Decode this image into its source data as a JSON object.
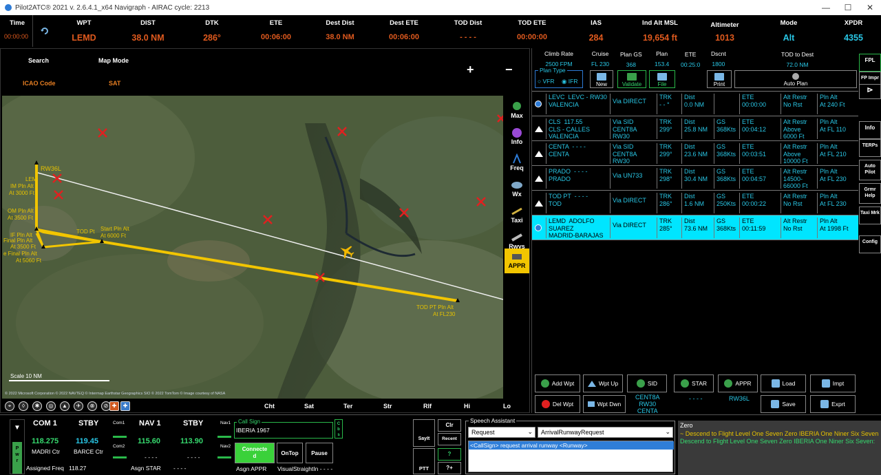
{
  "window": {
    "title": "Pilot2ATC® 2021 v. 2.6.4.1_x64     Navigraph - AIRAC cycle: 2213",
    "minimize": "—",
    "maximize": "☐",
    "close": "✕"
  },
  "status": {
    "time": {
      "label": "Time",
      "value": "00:00:00"
    },
    "cells": [
      {
        "label": "WPT",
        "value": "LEMD"
      },
      {
        "label": "DIST",
        "value": "38.0 NM"
      },
      {
        "label": "DTK",
        "value": "286°"
      },
      {
        "label": "ETE",
        "value": "00:06:00"
      },
      {
        "label": "Dest Dist",
        "value": "38.0 NM"
      },
      {
        "label": "Dest ETE",
        "value": "00:06:00"
      },
      {
        "label": "TOD Dist",
        "value": "- - - -"
      },
      {
        "label": "TOD ETE",
        "value": "00:00:00"
      },
      {
        "label": "IAS",
        "value": "284"
      },
      {
        "label": "Ind Alt MSL",
        "value": "19,654 ft"
      },
      {
        "label": "Altimeter",
        "value": "1013"
      },
      {
        "label": "Mode",
        "value": "Alt"
      },
      {
        "label": "XPDR",
        "value": "4355"
      }
    ]
  },
  "maptop": {
    "search": "Search",
    "map_mode": "Map Mode",
    "search_value": "ICAO Code",
    "map_mode_value": "SAT",
    "zoom_in": "+",
    "zoom_out": "−"
  },
  "map": {
    "labels": [
      "RW36L",
      "LEM",
      "IM Pln Alt",
      "At 3000 Ft",
      "OM Pln Alt",
      "At 3500 Ft",
      "IF Pln Alt",
      "Final Pln Alt",
      "At 3500 Ft",
      "TOD Pt",
      "Start Pln Alt",
      "At 6000 Ft",
      "e Final Pln Alt",
      "At 5060 Ft",
      "TOD PT Pln Alt",
      "At FL230"
    ],
    "scale": "Scale 10 NM",
    "copyright": "© 2022 Microsoft Corporation © 2022 NAVTEQ © Intermap Earthstar Geographics SIO © 2022 TomTom © Image courtesy of NASA"
  },
  "mapside": [
    {
      "label": "Max",
      "icon": "zoom-max-icon",
      "color": "#3aa04a"
    },
    {
      "label": "Info",
      "icon": "info-icon",
      "color": "#9a4ad6"
    },
    {
      "label": "Freq",
      "icon": "radio-freq-icon",
      "color": "#2d7bd6"
    },
    {
      "label": "Wx",
      "icon": "weather-icon",
      "color": "#7fa8c8"
    },
    {
      "label": "Taxi",
      "icon": "taxi-icon",
      "color": "#d0b040"
    },
    {
      "label": "Rwys",
      "icon": "runway-icon",
      "color": "#bbbbbb"
    },
    {
      "label": "APPR",
      "icon": "approach-icon",
      "color": "#555555"
    }
  ],
  "mapbar": [
    "Cht",
    "Sat",
    "Ter",
    "Str",
    "Rlf",
    "Hi",
    "Lo"
  ],
  "planhdr": [
    {
      "label": "Climb Rate",
      "value": "2500 FPM"
    },
    {
      "label": "Cruise",
      "value": "FL 230"
    },
    {
      "label": "Plan GS",
      "value": "368"
    },
    {
      "label": "Plan",
      "value": "153.4"
    },
    {
      "label": "ETE",
      "value": "00:25:0"
    },
    {
      "label": "Dscnt",
      "value": "1800"
    },
    {
      "label": "TOD to Dest",
      "value": "72.0 NM"
    }
  ],
  "plantype": {
    "caption": "Plan Type",
    "vfr": "VFR",
    "ifr": "IFR"
  },
  "planbtns": {
    "new": "New",
    "validate": "Validate",
    "file": "File",
    "print": "Print",
    "autoplan": "Auto Plan"
  },
  "legs": [
    {
      "name": "LEVC  LEVC - RW30\nVALENCIA",
      "via": "Via DIRECT",
      "trk": "TRK\n- - °",
      "dist": "Dist\n0.0 NM",
      "gs": "",
      "ete": "ETE\n00:00:00",
      "alt": "Alt Restr\nNo Rst",
      "pln": "Pln Alt\nAt 240 Ft"
    },
    {
      "name": "CLS  117.55\nCLS - CALLES\nVALENCIA",
      "via": "Via SID\nCENT8A\nRW30",
      "trk": "TRK\n299°",
      "dist": "Dist\n25.8 NM",
      "gs": "GS\n368Kts",
      "ete": "ETE\n00:04:12",
      "alt": "Alt Restr\nAbove\n6000 Ft",
      "pln": "Pln Alt\nAt FL 110"
    },
    {
      "name": "CENTA  - - - -\nCENTA",
      "via": "Via SID\nCENT8A\nRW30",
      "trk": "TRK\n299°",
      "dist": "Dist\n23.6 NM",
      "gs": "GS\n368Kts",
      "ete": "ETE\n00:03:51",
      "alt": "Alt Restr\nAbove\n10000 Ft",
      "pln": "Pln Alt\nAt FL 210"
    },
    {
      "name": "PRADO  - - - -\nPRADO",
      "via": "Via UN733",
      "trk": "TRK\n298°",
      "dist": "Dist\n30.4 NM",
      "gs": "GS\n368Kts",
      "ete": "ETE\n00:04:57",
      "alt": "Alt Restr\n14500-\n66000 Ft",
      "pln": "Pln Alt\nAt FL 230"
    },
    {
      "name": "TOD PT  - - - -\nTOD",
      "via": "Via DIRECT",
      "trk": "TRK\n286°",
      "dist": "Dist\n1.6 NM",
      "gs": "GS\n250Kts",
      "ete": "ETE\n00:00:22",
      "alt": "Alt Restr\nNo Rst",
      "pln": "Pln Alt\nAt FL 230"
    },
    {
      "name": "LEMD  ADOLFO\nSUAREZ\nMADRID-BARAJAS",
      "via": "Via DIRECT",
      "trk": "TRK\n285°",
      "dist": "Dist\n73.6 NM",
      "gs": "GS\n368Kts",
      "ete": "ETE\n00:11:59",
      "alt": "Alt Restr\nNo Rst",
      "pln": "Pln Alt\nAt 1998 Ft"
    }
  ],
  "actions": {
    "add_wpt": "Add Wpt",
    "wpt_up": "Wpt Up",
    "sid": "SID",
    "star": "STAR",
    "appr": "APPR",
    "load": "Load",
    "impt": "Impt",
    "del_wpt": "Del Wpt",
    "wpt_dwn": "Wpt Dwn",
    "sid_val": "CENT8A\nRW30\nCENTA",
    "star_val": "- - - -",
    "appr_val": "RW36L",
    "save": "Save",
    "exprt": "Exprt"
  },
  "farright": [
    "FPL",
    "FP Impr",
    "Info",
    "TERPs",
    "Auto\nPilot",
    "Grmr\nHelp",
    "Taxi Mrk",
    "Config"
  ],
  "radio": {
    "com1": "COM 1",
    "com1_stby": "STBY",
    "nav1": "NAV 1",
    "nav1_stby": "STBY",
    "com1_freq": "118.275",
    "com1_stby_freq": "119.45",
    "nav1_freq": "115.60",
    "nav1_stby_freq": "113.90",
    "com1_name": "MADRI Ctr",
    "com1_stby_name": "BARCE Ctr",
    "nav1_name": "- - - -",
    "nav1_stby_name": "- - - -",
    "com1_small": "Com1",
    "com2_small": "Com2",
    "nav1_small": "Nav1",
    "nav2_small": "Nav2",
    "assigned_freq_label": "Assigned Freq",
    "assigned_freq": "118.27",
    "asgn_star_label": "Asgn STAR",
    "asgn_star": "- - - -",
    "pwr": "P\nw\nr"
  },
  "callsign": {
    "caption": "Call Sign",
    "value": "IBERIA 1967",
    "cbs": "C\nb\ns"
  },
  "ctrl": {
    "connected": "Connecte\nd",
    "ontop": "OnTop",
    "pause": "Pause",
    "asgn_appr": "Asgn APPR",
    "visual": "VisualStraightIn -   - - -"
  },
  "pttbtns": {
    "sayit": "SayIt",
    "clr": "Clr",
    "recent": "Recent",
    "ptt": "PTT",
    "help": "?",
    "plus": "?+"
  },
  "speech": {
    "caption": "Speech Assistant",
    "category": "Request",
    "phrase": "ArrivalRunwayRequest",
    "suggestion": "<CallSign> request arrival runway <Runway>"
  },
  "log": [
    {
      "t": "Zero",
      "c": "a"
    },
    {
      "t": "~ Descend to Flight Level One Seven Zero IBERIA One Niner Six Seven",
      "c": "b"
    },
    {
      "t": " Descend to Flight Level One Seven Zero IBERIA One Niner Six Seven:",
      "c": "c"
    }
  ]
}
